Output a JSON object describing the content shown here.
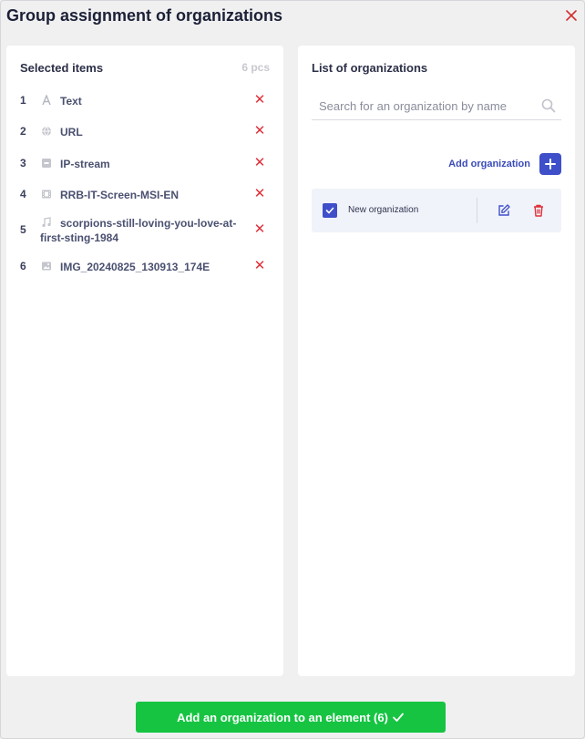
{
  "dialog": {
    "title": "Group assignment of organizations",
    "close_icon": "close-icon"
  },
  "selected": {
    "heading": "Selected items",
    "count": "6 pcs",
    "items": [
      {
        "num": "1",
        "icon": "text-icon",
        "label": "Text"
      },
      {
        "num": "2",
        "icon": "globe-icon",
        "label": "URL"
      },
      {
        "num": "3",
        "icon": "stream-icon",
        "label": "IP-stream"
      },
      {
        "num": "4",
        "icon": "film-icon",
        "label": "RRB-IT-Screen-MSI-EN"
      },
      {
        "num": "5",
        "icon": "music-icon",
        "label": "scorpions-still-loving-you-love-at-first-sting-1984"
      },
      {
        "num": "6",
        "icon": "image-icon",
        "label": "IMG_20240825_130913_174E"
      }
    ],
    "remove_icon": "close-icon"
  },
  "organizations": {
    "heading": "List of organizations",
    "search_placeholder": "Search for an organization by name",
    "add_label": "Add organization",
    "rows": [
      {
        "name": "New organization",
        "checked": true
      }
    ]
  },
  "footer": {
    "submit_label": "Add an organization to an element (6)"
  },
  "colors": {
    "accent": "#3f4fc9",
    "danger": "#e0303a",
    "success": "#16c442"
  }
}
